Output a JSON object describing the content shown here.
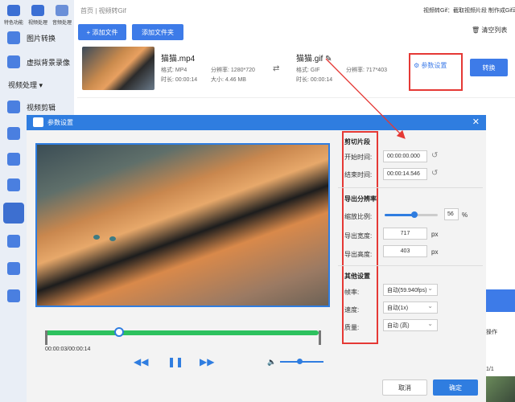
{
  "sidebar": {
    "top_icons": [
      {
        "label": "特色功能",
        "icon": "star-icon"
      },
      {
        "label": "视频处理",
        "icon": "video-icon"
      },
      {
        "label": "音频处理",
        "icon": "audio-icon"
      }
    ],
    "items": [
      {
        "label": "图片转换",
        "icon": "image-icon"
      },
      {
        "label": "虚拟背景录像",
        "icon": "camera-icon"
      },
      {
        "label": "视频处理 ▾",
        "icon": ""
      },
      {
        "label": "视频剪辑",
        "icon": "scissors-icon"
      }
    ]
  },
  "topbar": {
    "breadcrumb": "首页 | 视频转Gif",
    "right_text": "视频转Gif：截取视频片段 制作成Gif动图"
  },
  "toolbar": {
    "add_file": "+ 添加文件",
    "add_folder": "添加文件夹",
    "clear_list": "清空列表"
  },
  "file": {
    "src_name": "猫猫.mp4",
    "src_format_label": "格式:",
    "src_format": "MP4",
    "src_res_label": "分辨率:",
    "src_res": "1280*720",
    "src_dur_label": "时长:",
    "src_dur": "00:00:14",
    "src_size_label": "大小:",
    "src_size": "4.46 MB",
    "dst_name": "猫猫.gif",
    "dst_format_label": "格式:",
    "dst_format": "GIF",
    "dst_res_label": "分辨率:",
    "dst_res": "717*403",
    "dst_dur_label": "时长:",
    "dst_dur": "00:00:14",
    "param_btn": "参数设置",
    "convert_btn": "转换"
  },
  "dialog": {
    "title": "参数设置",
    "close": "✕",
    "player": {
      "time": "00:00:03/00:00:14",
      "progress": 0.27,
      "volume": 0.45
    },
    "clip": {
      "section": "剪切片段",
      "start_label": "开始时间:",
      "start_value": "00:00:00.000",
      "end_label": "结束时间:",
      "end_value": "00:00:14.546"
    },
    "resolution": {
      "section": "导出分辨率",
      "scale_label": "缩放比例:",
      "scale_value": "56",
      "scale_unit": "%",
      "width_label": "导出宽度:",
      "width_value": "717",
      "width_unit": "px",
      "height_label": "导出高度:",
      "height_value": "403",
      "height_unit": "px"
    },
    "other": {
      "section": "其他设置",
      "fps_label": "帧率:",
      "fps_value": "自动(59.940fps)",
      "speed_label": "速度:",
      "speed_value": "自动(1x)",
      "quality_label": "质量:",
      "quality_value": "自动 (高)"
    },
    "cancel": "取消",
    "ok": "确定"
  },
  "background": {
    "ops_text": "操作",
    "page_text": "1/1"
  },
  "colors": {
    "accent": "#2f7de0",
    "highlight": "#e53935",
    "progress": "#2dc15e"
  }
}
